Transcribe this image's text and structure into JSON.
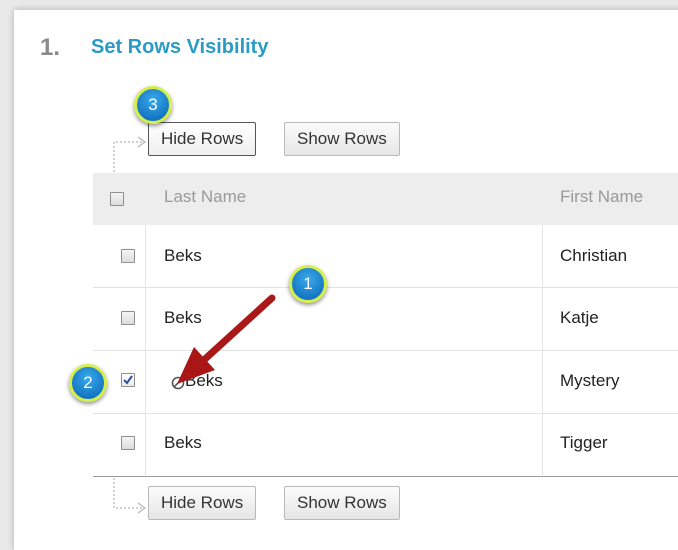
{
  "step": {
    "number": "1.",
    "title": "Set Rows Visibility"
  },
  "toolbar_top": {
    "hide_label": "Hide Rows",
    "show_label": "Show Rows"
  },
  "toolbar_bottom": {
    "hide_label": "Hide Rows",
    "show_label": "Show Rows"
  },
  "table": {
    "headers": [
      "Last Name",
      "First Name"
    ],
    "rows": [
      {
        "last": "Beks",
        "first": "Christian",
        "checked": false,
        "hidden": false
      },
      {
        "last": "Beks",
        "first": "Katje",
        "checked": false,
        "hidden": false
      },
      {
        "last": "Beks",
        "first": "Mystery",
        "checked": true,
        "hidden": true
      },
      {
        "last": "Beks",
        "first": "Tigger",
        "checked": false,
        "hidden": false
      }
    ]
  },
  "callouts": [
    "1",
    "2",
    "3"
  ],
  "icons": {
    "connector": "elbow-arrow-icon",
    "hidden_row": "hidden-row-icon",
    "checkmark": "checkmark-icon",
    "annotation_arrow": "red-arrow-icon"
  },
  "colors": {
    "title": "#2b9bc5",
    "badge_fill": "#1f86d4",
    "badge_ring": "#d6ee4a",
    "annotation_arrow": "#b21a1a",
    "header_bg": "#ededed"
  }
}
